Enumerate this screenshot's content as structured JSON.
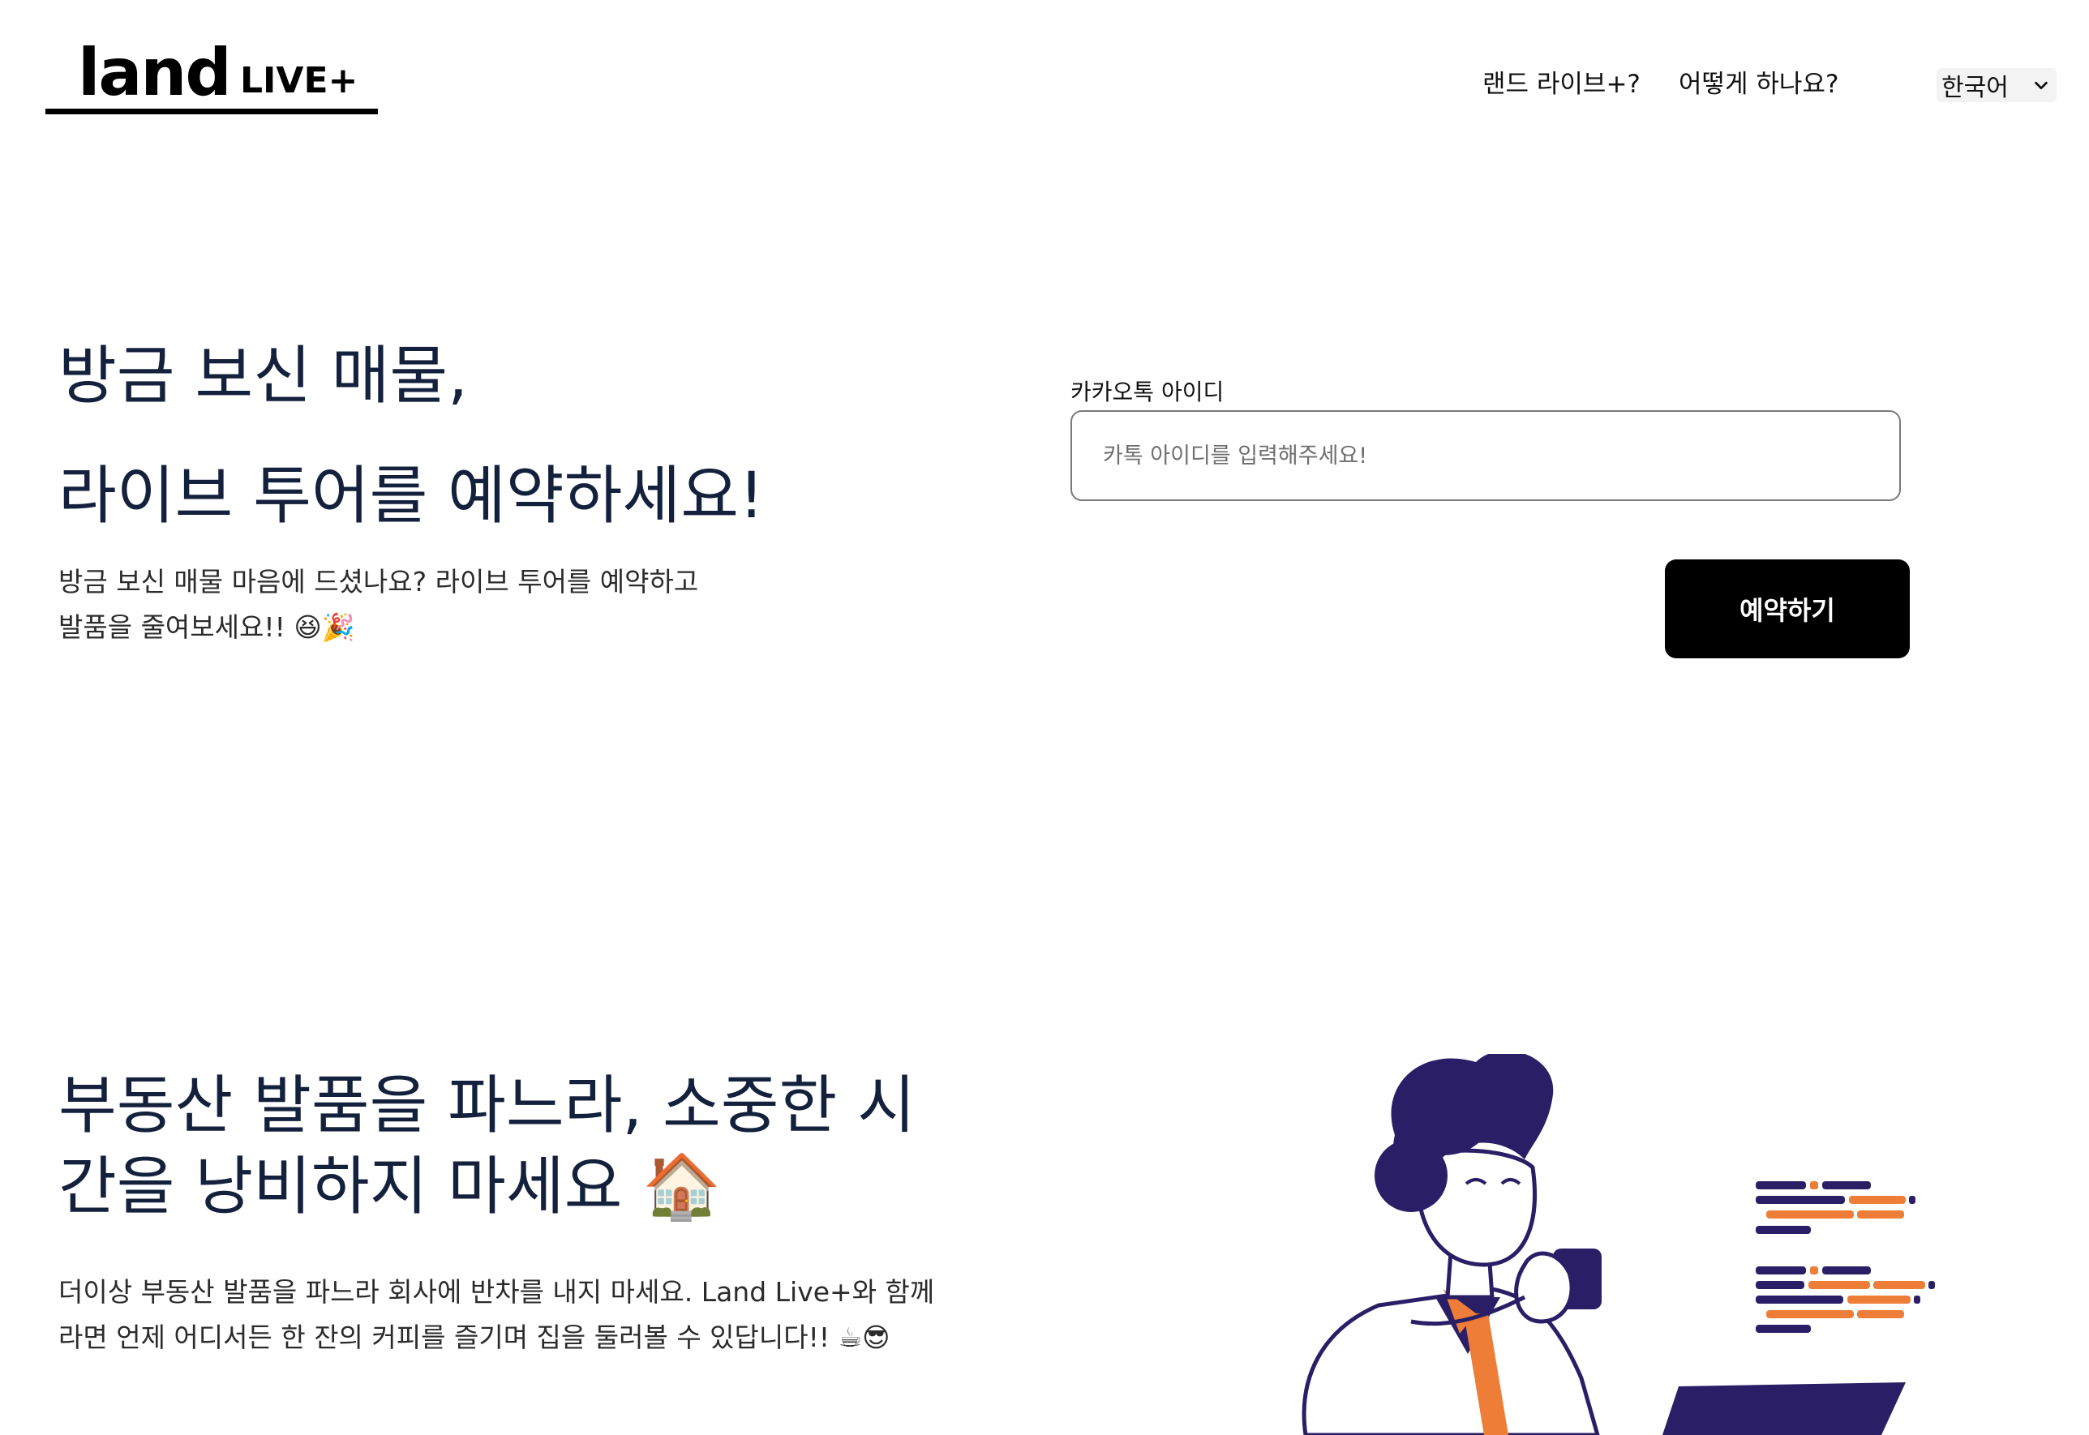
{
  "header": {
    "logo_main": "land",
    "logo_sub": "LIVE+",
    "nav": {
      "about_label": "랜드 라이브+?",
      "how_label": "어떻게 하나요?"
    },
    "language": {
      "selected": "한국어",
      "icon": "chevron-down-icon"
    }
  },
  "hero": {
    "title_line1": "방금 보신 매물,",
    "title_line2": "라이브 투어를 예약하세요!",
    "desc_line1": "방금 보신 매물 마음에 드셨나요? 라이브 투어를 예약하고",
    "desc_line2": "발품을 줄여보세요!! 😆🎉"
  },
  "reservation_form": {
    "label": "카카오톡 아이디",
    "input_value": "",
    "placeholder": "카톡 아이디를 입력해주세요!",
    "submit_label": "예약하기"
  },
  "section2": {
    "title_line1": "부동산 발품을 파느라, 소중한 시",
    "title_line2": "간을 낭비하지 마세요 🏠",
    "desc_line1": "더이상 부동산 발품을 파느라 회사에 반차를 내지 마세요. Land Live+와 함께",
    "desc_line2": "라면 언제 어디서든 한 잔의 커피를 즐기며 집을 둘러볼 수 있답니다!! ☕😎"
  },
  "colors": {
    "heading": "#14213d",
    "illustration_navy": "#2a1f66",
    "illustration_orange": "#ee7d38",
    "button_bg": "#000000"
  }
}
